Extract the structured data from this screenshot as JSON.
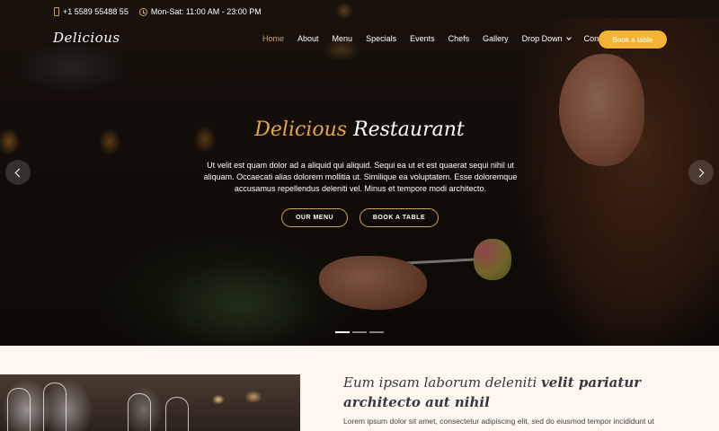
{
  "topbar": {
    "phone": "+1 5589 55488 55",
    "hours": "Mon-Sat: 11:00 AM - 23:00 PM"
  },
  "header": {
    "logo": "Delicious",
    "nav": [
      {
        "label": "Home",
        "active": true
      },
      {
        "label": "About"
      },
      {
        "label": "Menu"
      },
      {
        "label": "Specials"
      },
      {
        "label": "Events"
      },
      {
        "label": "Chefs"
      },
      {
        "label": "Gallery"
      },
      {
        "label": "Drop Down"
      },
      {
        "label": "Contact"
      }
    ],
    "book_button": "Book a table"
  },
  "hero": {
    "title_accent": "Delicious",
    "title_main": "Restaurant",
    "text": "Ut velit est quam dolor ad a aliquid qui aliquid. Sequi ea ut et est quaerat sequi nihil ut aliquam. Occaecati alias dolorem mollitia ut. Similique ea voluptatem. Esse doloremque accusamus repellendus deleniti vel. Minus et tempore modi architecto.",
    "btn_menu": "OUR MENU",
    "btn_book": "BOOK A TABLE",
    "slides": 3,
    "active_slide": 1
  },
  "about": {
    "heading_normal": "Eum ipsam laborum deleniti",
    "heading_bold": "velit pariatur architecto aut nihil",
    "text": "Lorem ipsum dolor sit amet, consectetur adipiscing elit, sed do eiusmod tempor incididunt ut"
  },
  "colors": {
    "accent": "#cda45e",
    "button": "#f3b334"
  }
}
